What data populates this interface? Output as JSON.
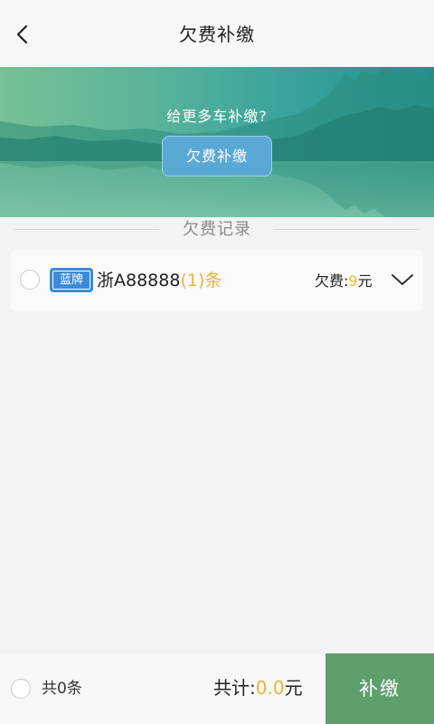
{
  "header": {
    "title": "欠费补缴",
    "back_icon": "chevron-left-icon"
  },
  "banner": {
    "prompt": "给更多车补缴?",
    "button_label": "欠费补缴"
  },
  "records": {
    "section_title": "欠费记录",
    "items": [
      {
        "plate_type": "蓝牌",
        "plate_number": "浙A88888",
        "count_text": "(1)条",
        "fee_label": "欠费:",
        "fee_amount": "9",
        "fee_unit": "元",
        "expand_icon": "chevron-down-icon"
      }
    ]
  },
  "footer": {
    "count_text": "共0条",
    "total_label": "共计:",
    "total_value": "0.0",
    "total_unit": "元",
    "pay_button_label": "补缴"
  },
  "colors": {
    "accent_amount": "#e9b63a",
    "plate_blue": "#3e8ad8",
    "pay_button": "#5f9e6d",
    "banner_button": "#5aa9d4"
  }
}
